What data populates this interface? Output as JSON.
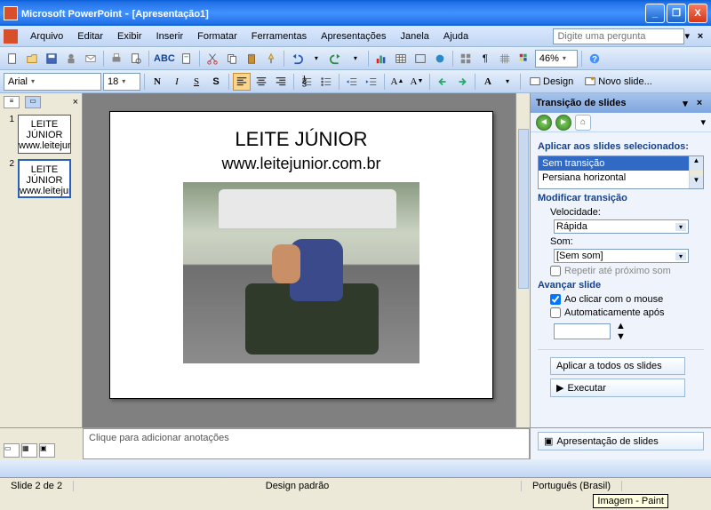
{
  "titlebar": {
    "app": "Microsoft PowerPoint",
    "doc": "[Apresentação1]"
  },
  "menu": {
    "items": [
      "Arquivo",
      "Editar",
      "Exibir",
      "Inserir",
      "Formatar",
      "Ferramentas",
      "Apresentações",
      "Janela",
      "Ajuda"
    ],
    "question_placeholder": "Digite uma pergunta"
  },
  "toolbar1": {
    "zoom": "46%"
  },
  "toolbar2": {
    "font": "Arial",
    "size": "18",
    "design_label": "Design",
    "new_slide_label": "Novo slide..."
  },
  "thumbs": {
    "slides": [
      {
        "num": "1",
        "title": "LEITE JÚNIOR",
        "sub": "www.leitejunior.com.br"
      },
      {
        "num": "2",
        "title": "LEITE JÚNIOR",
        "sub": "www.leitejunior.com.br"
      }
    ]
  },
  "slide": {
    "title": "LEITE JÚNIOR",
    "subtitle": "www.leitejunior.com.br"
  },
  "taskpane": {
    "title": "Transição de slides",
    "apply_label": "Aplicar aos slides selecionados:",
    "transitions": [
      "Sem transição",
      "Persiana horizontal"
    ],
    "modify_label": "Modificar transição",
    "speed_label": "Velocidade:",
    "speed_value": "Rápida",
    "sound_label": "Som:",
    "sound_value": "[Sem som]",
    "repeat_label": "Repetir até próximo som",
    "advance_label": "Avançar slide",
    "advance_click": "Ao clicar com o mouse",
    "advance_auto": "Automaticamente após",
    "apply_all": "Aplicar a todos os slides",
    "execute": "Executar",
    "slideshow": "Apresentação de slides"
  },
  "notes": {
    "placeholder": "Clique para adicionar anotações"
  },
  "statusbar": {
    "slide": "Slide 2 de 2",
    "design": "Design padrão",
    "lang": "Português (Brasil)",
    "tooltip": "Imagem - Paint"
  }
}
